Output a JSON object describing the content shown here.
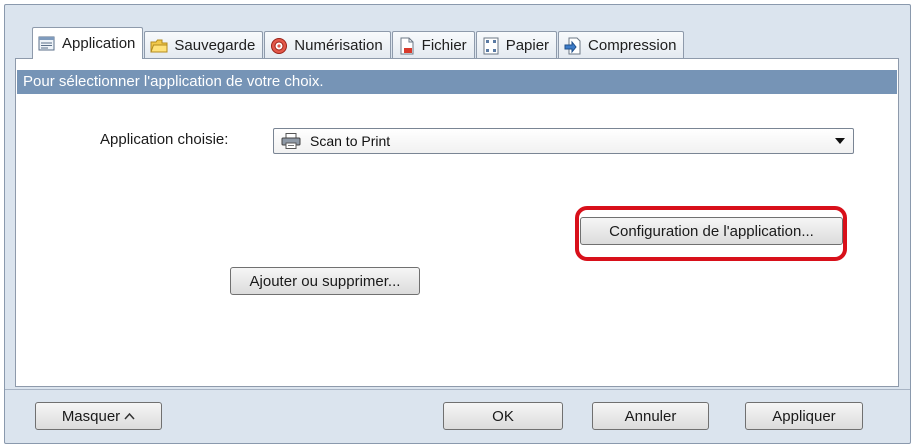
{
  "tabs": [
    {
      "label": "Application",
      "icon": "application-icon",
      "active": true
    },
    {
      "label": "Sauvegarde",
      "icon": "folder-icon",
      "active": false
    },
    {
      "label": "Numérisation",
      "icon": "scan-icon",
      "active": false
    },
    {
      "label": "Fichier",
      "icon": "file-icon",
      "active": false
    },
    {
      "label": "Papier",
      "icon": "paper-icon",
      "active": false
    },
    {
      "label": "Compression",
      "icon": "compression-icon",
      "active": false
    }
  ],
  "panel": {
    "description": "Pour sélectionner l'application de votre choix.",
    "app_label": "Application choisie:",
    "app_selected": "Scan to Print",
    "app_selected_icon": "printer-icon",
    "config_button": "Configuration de l'application...",
    "add_remove_button": "Ajouter ou supprimer..."
  },
  "footer": {
    "hide_button": "Masquer",
    "ok_button": "OK",
    "cancel_button": "Annuler",
    "apply_button": "Appliquer"
  },
  "colors": {
    "accent_bar": "#7694b6",
    "highlight": "#d8101a",
    "dialog_bg": "#dbe4ee"
  }
}
